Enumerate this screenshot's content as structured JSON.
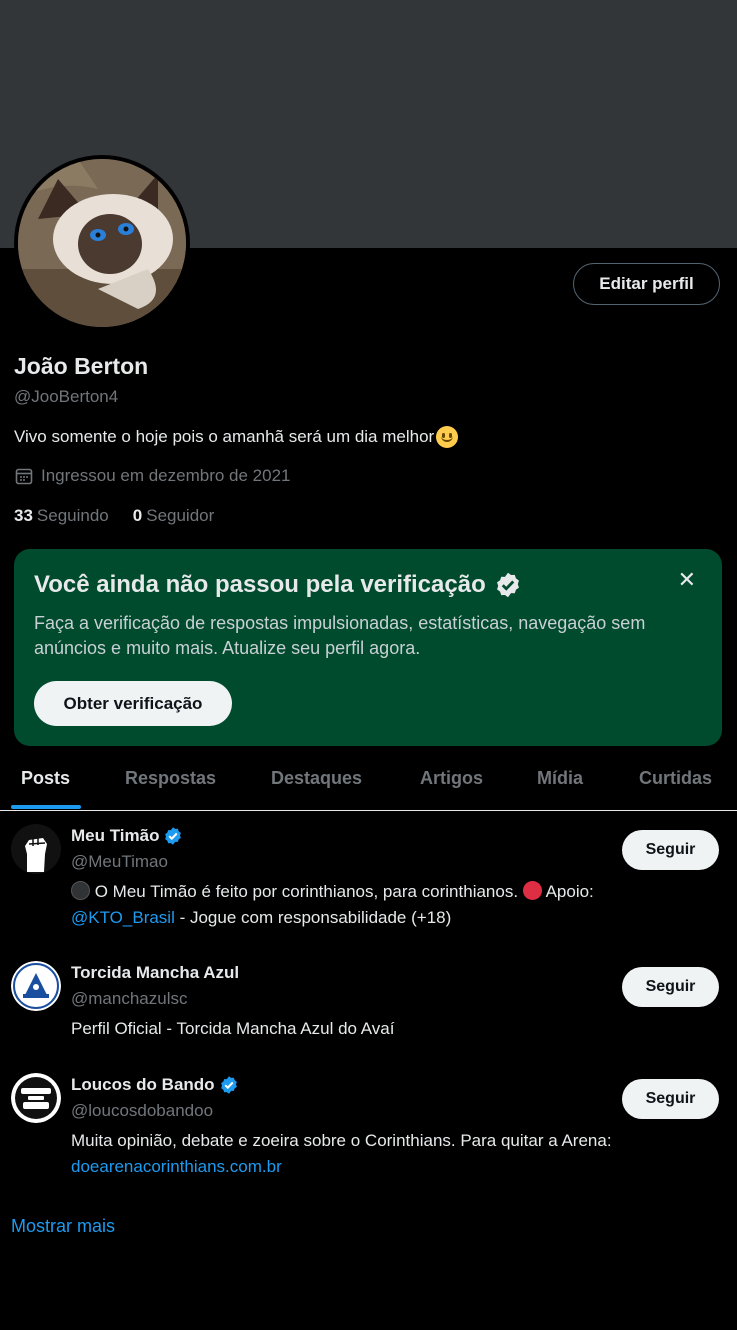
{
  "profile": {
    "name": "João Berton",
    "handle": "@JooBerton4",
    "bio": "Vivo somente o hoje pois o amanhã será um dia melhor",
    "joined": "Ingressou em dezembro de 2021",
    "following_count": "33",
    "following_label": "Seguindo",
    "followers_count": "0",
    "followers_label": "Seguidor",
    "edit_button": "Editar perfil"
  },
  "verification_card": {
    "title": "Você ainda não passou pela verificação",
    "text": "Faça a verificação de respostas impulsionadas, estatísticas, navegação sem anúncios e muito mais. Atualize seu perfil agora.",
    "button": "Obter verificação",
    "close": "✕"
  },
  "tabs": [
    "Posts",
    "Respostas",
    "Destaques",
    "Artigos",
    "Mídia",
    "Curtidas"
  ],
  "suggestions": [
    {
      "name": "Meu Timão",
      "handle": "@MeuTimao",
      "verified": true,
      "bio_part1": " O Meu Timão é feito por corinthianos, para corinthianos. ",
      "bio_part2": " Apoio:",
      "bio_link": "@KTO_Brasil",
      "bio_part3": " - Jogue com responsabilidade (+18)",
      "button": "Seguir"
    },
    {
      "name": "Torcida Mancha Azul",
      "handle": "@manchazulsc",
      "verified": false,
      "bio": "Perfil Oficial - Torcida Mancha Azul do Avaí",
      "button": "Seguir"
    },
    {
      "name": "Loucos do Bando",
      "handle": "@loucosdobandoo",
      "verified": true,
      "bio": "Muita opinião, debate e zoeira sobre o Corinthians. Para quitar a Arena:",
      "bio_link": "doearenacorinthians.com.br",
      "button": "Seguir"
    }
  ],
  "show_more": "Mostrar mais",
  "colors": {
    "accent": "#1d9bf0",
    "verify_card_bg": "#004a2e",
    "banner": "#333639"
  }
}
